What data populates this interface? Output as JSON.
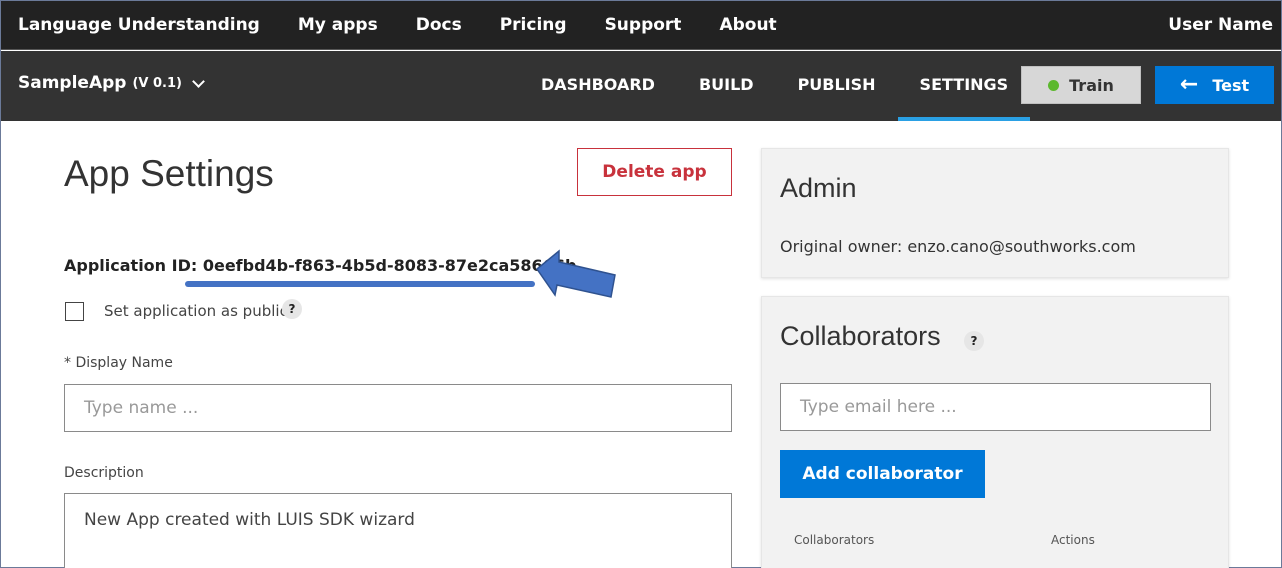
{
  "topnav": {
    "items": [
      "Language Understanding",
      "My apps",
      "Docs",
      "Pricing",
      "Support",
      "About"
    ],
    "user_name": "User Name"
  },
  "appbar": {
    "app_name": "SampleApp",
    "version": "(V 0.1)",
    "tabs": [
      "DASHBOARD",
      "BUILD",
      "PUBLISH",
      "SETTINGS"
    ],
    "active_tab": "SETTINGS",
    "train_label": "Train",
    "test_label": "Test"
  },
  "settings": {
    "title": "App Settings",
    "delete_label": "Delete app",
    "app_id_label": "Application ID:",
    "app_id_value": "0eefbd4b-f863-4b5d-8083-87e2ca58666b",
    "public_label": "Set application as public",
    "help_glyph": "?",
    "display_name_label": "* Display Name",
    "display_name_placeholder": "Type name ...",
    "description_label": "Description",
    "description_value": "New App created with LUIS SDK wizard"
  },
  "admin": {
    "title": "Admin",
    "owner_text": "Original owner: enzo.cano@southworks.com"
  },
  "collaborators": {
    "title": "Collaborators",
    "email_placeholder": "Type email here ...",
    "add_label": "Add collaborator",
    "col_collaborators": "Collaborators",
    "col_actions": "Actions"
  },
  "colors": {
    "accent": "#0078d7",
    "tab_underline": "#2aa0e4",
    "danger": "#c8323c",
    "train_dot": "#5cb82e",
    "annotation": "#4472c4"
  }
}
